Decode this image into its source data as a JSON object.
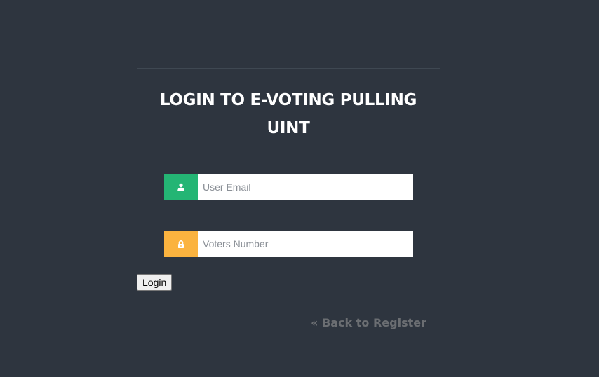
{
  "form": {
    "title": "LOGIN TO E-VOTING PULLING UINT",
    "email_field": {
      "placeholder": "User Email",
      "value": "",
      "icon": "user-icon",
      "icon_color": "#24b574"
    },
    "voter_field": {
      "placeholder": "Voters Number",
      "value": "",
      "icon": "lock-icon",
      "icon_color": "#fbb33f"
    },
    "login_label": "Login"
  },
  "footer": {
    "back_link": "« Back to Register"
  },
  "colors": {
    "background": "#2e353f",
    "title": "#ffffff",
    "link": "#6b6e72"
  }
}
